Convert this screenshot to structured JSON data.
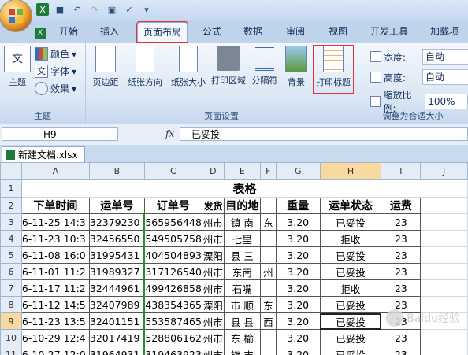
{
  "qat": {
    "icons": [
      "excel-icon",
      "save-icon",
      "undo-icon",
      "redo-icon",
      "print-preview-icon",
      "spelling-icon",
      "customize-icon"
    ]
  },
  "tabs": [
    "开始",
    "插入",
    "页面布局",
    "公式",
    "数据",
    "审阅",
    "视图",
    "开发工具",
    "加载项"
  ],
  "active_tab": "页面布局",
  "ribbon": {
    "theme": {
      "big_label": "主题",
      "colors": "颜色",
      "fonts": "字体",
      "effects": "效果",
      "group": "主题"
    },
    "page_setup": {
      "margins": "页边距",
      "orientation": "纸张方向",
      "size": "纸张大小",
      "print_area": "打印区域",
      "breaks": "分隔符",
      "background": "背景",
      "print_titles": "打印标题",
      "group": "页面设置"
    },
    "scale": {
      "width_label": "宽度:",
      "width_value": "自动",
      "height_label": "高度:",
      "height_value": "自动",
      "scale_label": "缩放比例:",
      "scale_value": "100%",
      "group": "调整为合适大小"
    }
  },
  "formula_bar": {
    "name_box": "H9",
    "fx": "fx",
    "content": "已妥投"
  },
  "workbook_tab": "新建文档.xlsx",
  "columns": [
    "A",
    "B",
    "C",
    "D",
    "E",
    "F",
    "G",
    "H",
    "I",
    "J"
  ],
  "selected_column": "H",
  "selected_row": "9",
  "sheet_title": "表格",
  "headers": [
    "下单时间",
    "运单号",
    "订单号",
    "发货",
    "目的地",
    "",
    "重量",
    "运单状态",
    "运费"
  ],
  "rows": [
    {
      "n": "3",
      "a": "6-11-25 14:3",
      "b": "32379230",
      "c": "565956448",
      "d": "州市",
      "e": "镇 南",
      "f": "东",
      "g": "3.20",
      "h": "已妥投",
      "i": "23"
    },
    {
      "n": "4",
      "a": "6-11-23 10:3",
      "b": "32456550",
      "c": "549505758",
      "d": "州市",
      "e": "七里",
      "f": "",
      "g": "3.20",
      "h": "拒收",
      "i": "23"
    },
    {
      "n": "5",
      "a": "6-11-08 16:0",
      "b": "31995431",
      "c": "404504893",
      "d": "溧阳",
      "e": "县 三",
      "f": "",
      "g": "3.20",
      "h": "已妥投",
      "i": "23"
    },
    {
      "n": "6",
      "a": "6-11-01 11:2",
      "b": "31989327",
      "c": "317126540",
      "d": "州市",
      "e": "东南",
      "f": "州",
      "g": "3.20",
      "h": "已妥投",
      "i": "23"
    },
    {
      "n": "7",
      "a": "6-11-17 11:2",
      "b": "32444961",
      "c": "499426858",
      "d": "州市",
      "e": "石嘴",
      "f": "",
      "g": "3.20",
      "h": "拒收",
      "i": "23"
    },
    {
      "n": "8",
      "a": "6-11-12 14:5",
      "b": "32407989",
      "c": "438354365",
      "d": "溧阳",
      "e": "市 顺",
      "f": "东",
      "g": "3.20",
      "h": "已妥投",
      "i": "23"
    },
    {
      "n": "9",
      "a": "6-11-23 13:5",
      "b": "32401151",
      "c": "553587465",
      "d": "州市",
      "e": "县 县",
      "f": "西",
      "g": "3.20",
      "h": "已妥投",
      "i": "23"
    },
    {
      "n": "10",
      "a": "6-10-29 12:4",
      "b": "32017419",
      "c": "528806162",
      "d": "州市",
      "e": "东 榆",
      "f": "",
      "g": "3.20",
      "h": "已妥投",
      "i": "23"
    },
    {
      "n": "11",
      "a": "6-10-27 12:0",
      "b": "31964931",
      "c": "319463923",
      "d": "州市",
      "e": "旗 吉",
      "f": "",
      "g": "3.20",
      "h": "已妥投",
      "i": "23"
    }
  ],
  "watermark": "Baidu经验"
}
